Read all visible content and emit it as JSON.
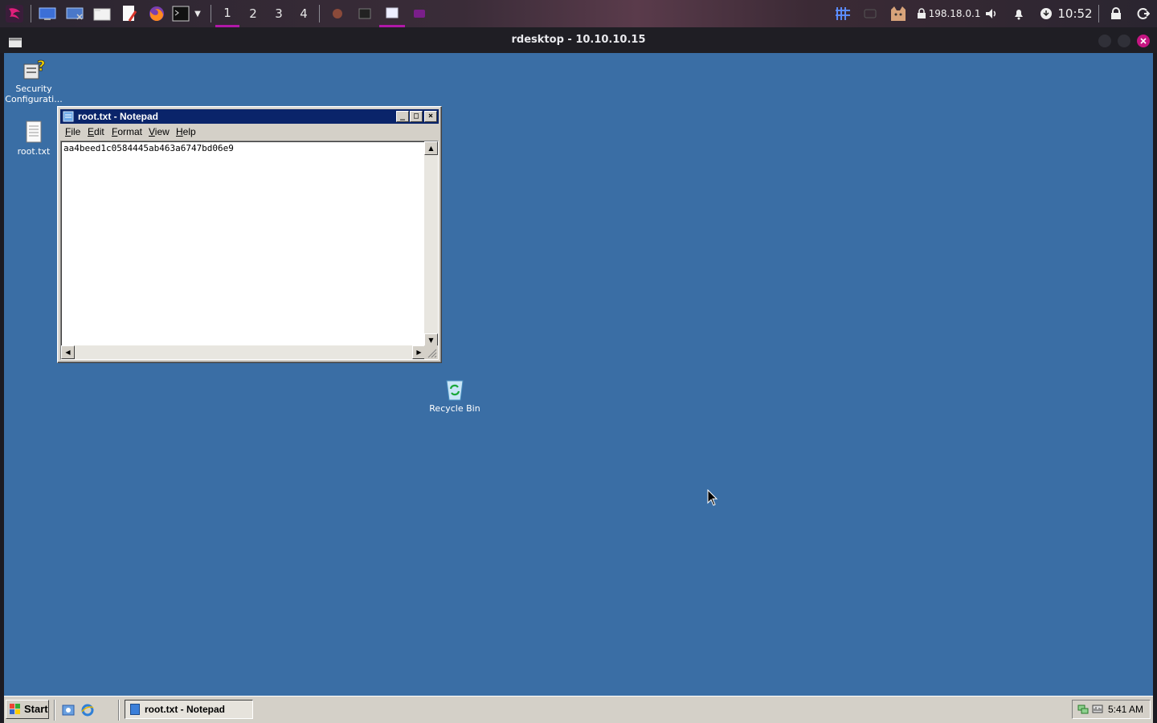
{
  "host_panel": {
    "workspaces": [
      "1",
      "2",
      "3",
      "4"
    ],
    "active_workspace": "1",
    "ip_address": "198.18.0.1",
    "clock": "10:52",
    "icons": [
      "kali-menu-icon",
      "desktop-icon",
      "show-desktop-icon",
      "file-manager-icon",
      "text-editor-icon",
      "firefox-icon",
      "terminal-icon",
      "terminal-dropdown-icon",
      "firefox-task-icon",
      "terminal-task-icon",
      "rdesktop-task-icon",
      "purple-task-icon",
      "network-graph-icon",
      "vpn-icon",
      "display-icon",
      "cat-icon",
      "lock-network-icon",
      "volume-icon",
      "bell-icon",
      "updates-icon",
      "lock-screen-icon",
      "logout-icon"
    ]
  },
  "rdesktop": {
    "title": "rdesktop - 10.10.10.15"
  },
  "remote_desktop": {
    "icons": [
      {
        "label": "Security Configurati..."
      },
      {
        "label": "root.txt"
      },
      {
        "label": "Recycle Bin"
      }
    ],
    "notepad": {
      "title": "root.txt - Notepad",
      "menu": [
        "File",
        "Edit",
        "Format",
        "View",
        "Help"
      ],
      "content": "aa4beed1c0584445ab463a6747bd06e9"
    },
    "taskbar": {
      "start_label": "Start",
      "task_label": "root.txt - Notepad",
      "time": "5:41 AM"
    }
  }
}
